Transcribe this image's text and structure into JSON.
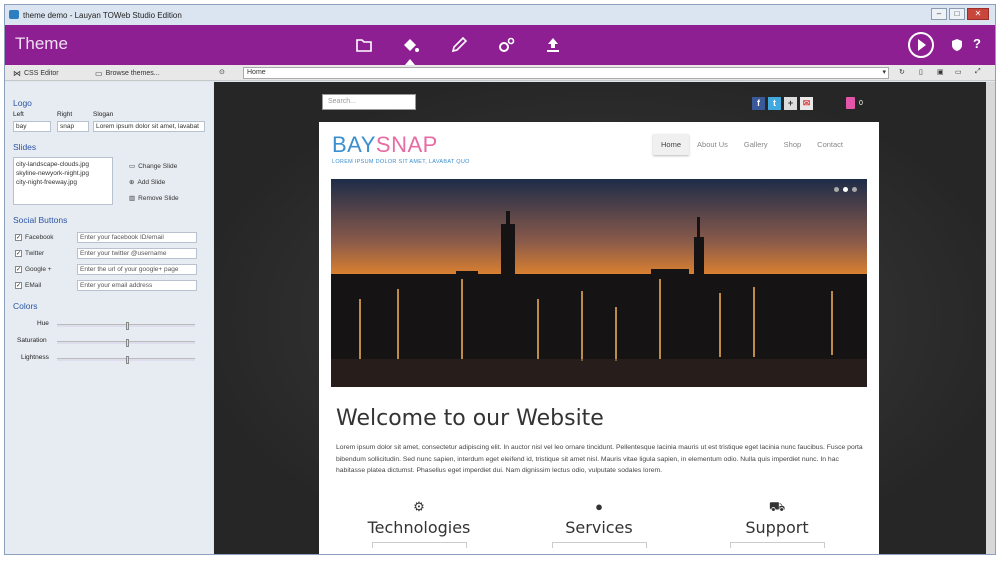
{
  "window": {
    "title": "theme demo - Lauyan TOWeb Studio Edition",
    "minimize": "–",
    "maximize": "□",
    "close": "✕"
  },
  "theme_bar": {
    "title": "Theme",
    "icons": [
      "folder-icon",
      "paint-bucket-icon",
      "pencil-icon",
      "gears-icon",
      "upload-icon"
    ],
    "right_icons": [
      "play-icon",
      "shield-icon",
      "help-icon"
    ],
    "help_label": "?"
  },
  "toolbar": {
    "css_editor": "CSS Editor",
    "browse_themes": "Browse themes...",
    "address": "Home"
  },
  "left_panel": {
    "logo": {
      "heading": "Logo",
      "left_label": "Left",
      "right_label": "Right",
      "slogan_label": "Slogan",
      "left_value": "bay",
      "right_value": "snap",
      "slogan_value": "Lorem ipsum dolor sit amet, lavabat"
    },
    "slides": {
      "heading": "Slides",
      "items": [
        "city-landscape-clouds.jpg",
        "skyline-newyork-night.jpg",
        "city-night-freeway.jpg"
      ],
      "change": "Change Slide",
      "add": "Add Slide",
      "remove": "Remove Slide"
    },
    "social": {
      "heading": "Social Buttons",
      "items": [
        {
          "label": "Facebook",
          "placeholder": "Enter your facebook ID/email"
        },
        {
          "label": "Twitter",
          "placeholder": "Enter your twitter @username"
        },
        {
          "label": "Google +",
          "placeholder": "Enter the url of your google+ page"
        },
        {
          "label": "EMail",
          "placeholder": "Enter your email address"
        }
      ]
    },
    "colors": {
      "heading": "Colors",
      "hue": "Hue",
      "saturation": "Saturation",
      "lightness": "Lightness",
      "hue_level": 0.5,
      "saturation_level": 0.5,
      "lightness_level": 0.5
    }
  },
  "preview": {
    "search_placeholder": "Search...",
    "cart_count": "0",
    "logo_part1": "BAY",
    "logo_part2": "SNAP",
    "tagline": "LOREM IPSUM DOLOR SIT AMET, LAVABAT QUO",
    "nav": [
      "Home",
      "About Us",
      "Gallery",
      "Shop",
      "Contact"
    ],
    "welcome": "Welcome to our Website",
    "lorem": "Lorem ipsum dolor sit amet, consectetur adipiscing elit. In auctor nisl vel leo ornare tincidunt. Pellentesque lacinia mauris ut est tristique eget lacinia nunc faucibus. Fusce porta bibendum sollicitudin. Sed nunc sapien, interdum eget eleifend id, tristique sit amet nisl. Mauris vitae ligula sapien, in elementum odio. Nulla quis imperdiet nunc. In hac habitasse platea dictumst. Phasellus eget imperdiet dui. Nam dignissim lectus odio, vulputate sodales lorem.",
    "features": [
      {
        "title": "Technologies",
        "icon": "gears-icon"
      },
      {
        "title": "Services",
        "icon": "user-icon"
      },
      {
        "title": "Support",
        "icon": "truck-icon"
      }
    ]
  },
  "colors": {
    "theme_bar": "#8e1f93",
    "logo_blue": "#3a8fcf",
    "logo_pink": "#e86ba3"
  }
}
